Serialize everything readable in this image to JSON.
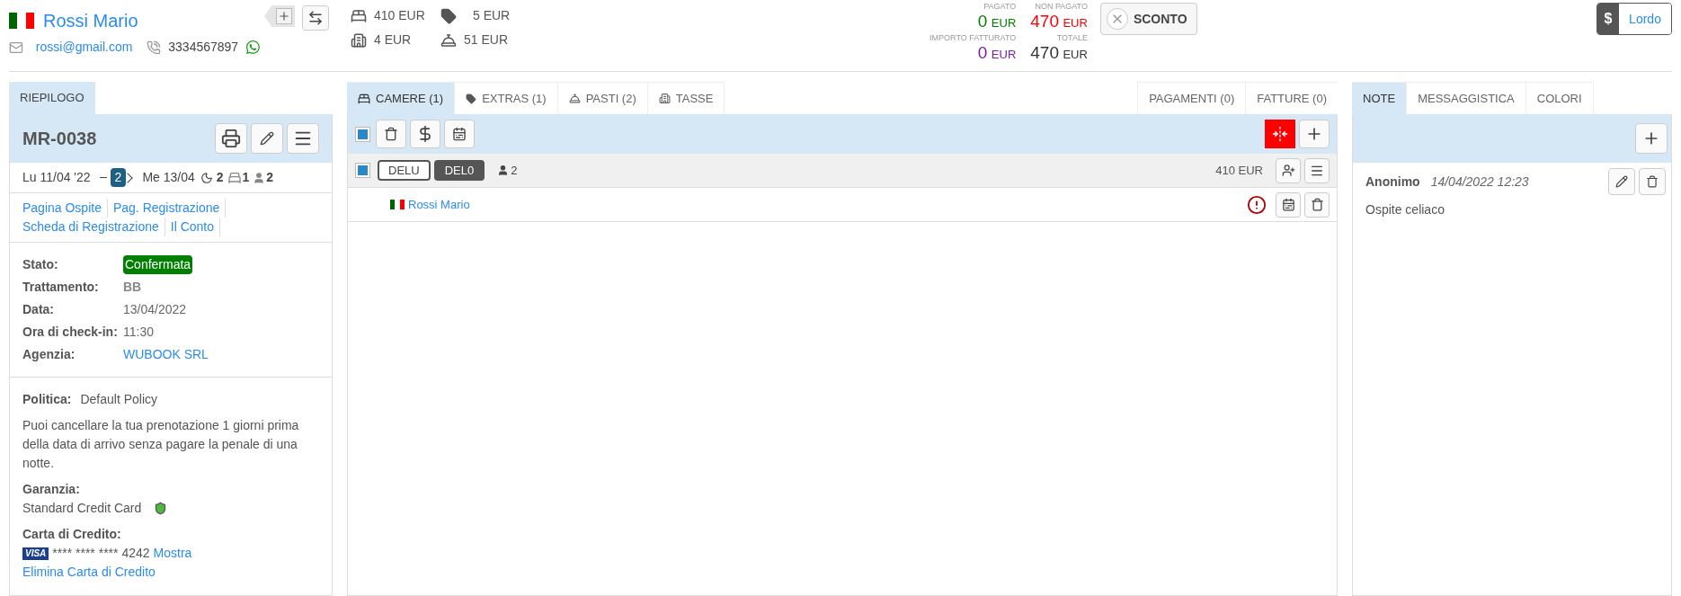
{
  "guest": {
    "name": "Rossi Mario",
    "email": "rossi@gmail.com",
    "phone": "3334567897"
  },
  "stats": [
    {
      "kind": "rooms",
      "value": "410 EUR"
    },
    {
      "kind": "extras",
      "value": "5 EUR"
    },
    {
      "kind": "taxes",
      "value": "4 EUR"
    },
    {
      "kind": "meals",
      "value": "51 EUR"
    }
  ],
  "totals": [
    {
      "label": "PAGATO",
      "amount": "0",
      "currency": "EUR",
      "color": "#008000"
    },
    {
      "label": "NON PAGATO",
      "amount": "470",
      "currency": "EUR",
      "color": "#ff0000"
    },
    {
      "label": "IMPORTO FATTURATO",
      "amount": "0",
      "currency": "EUR",
      "color": "#7b1fa2"
    },
    {
      "label": "TOTALE",
      "amount": "470",
      "currency": "EUR",
      "color": "#333333"
    }
  ],
  "discount_button": "SCONTO",
  "price_toggle": {
    "symbol": "$",
    "label": "Lordo"
  },
  "summary": {
    "tab": "RIEPILOGO",
    "code": "MR-0038",
    "checkin": "Lu 11/04 '22",
    "nights_badge": "2",
    "checkout": "Me 13/04",
    "nights": "2",
    "rooms": "1",
    "guests": "2",
    "links": [
      "Pagina Ospite",
      "Pag. Registrazione",
      "Scheda di Registrazione",
      "Il Conto"
    ],
    "fields": [
      {
        "label": "Stato:",
        "value": "Confermata",
        "kind": "badge"
      },
      {
        "label": "Trattamento:",
        "value": "BB",
        "kind": "bold"
      },
      {
        "label": "Data:",
        "value": "13/04/2022",
        "kind": "text"
      },
      {
        "label": "Ora di check-in:",
        "value": "11:30",
        "kind": "text"
      },
      {
        "label": "Agenzia:",
        "value": "WUBOOK SRL",
        "kind": "link"
      }
    ],
    "policy_label": "Politica:",
    "policy": "Default Policy",
    "policy_text": "Puoi cancellare la tua prenotazione 1 giorni prima della data di arrivo senza pagare la penale di una notte.",
    "guarantee_label": "Garanzia:",
    "guarantee": "Standard Credit Card",
    "card_label": "Carta di Credito:",
    "card_brand": "VISA",
    "card_number": "**** **** **** 4242",
    "card_show": "Mostra",
    "card_delete": "Elimina Carta di Credito"
  },
  "room_tabs": [
    {
      "label": "CAMERE (1)",
      "kind": "bed",
      "selected": true
    },
    {
      "label": "EXTRAS (1)",
      "kind": "tag",
      "selected": false
    },
    {
      "label": "PASTI (2)",
      "kind": "meal",
      "selected": false
    },
    {
      "label": "TASSE",
      "kind": "building",
      "selected": false
    }
  ],
  "right_tabs": [
    {
      "label": "PAGAMENTI (0)",
      "selected": false
    },
    {
      "label": "FATTURE (0)",
      "selected": false
    }
  ],
  "toolbar": {
    "checked": true
  },
  "room": {
    "checked": true,
    "codes": [
      {
        "label": "DELU",
        "selected": false
      },
      {
        "label": "DEL0",
        "selected": true
      }
    ],
    "guests": "2",
    "price": "410 EUR",
    "occupant": "Rossi Mario"
  },
  "note_tabs": [
    {
      "label": "NOTE",
      "selected": true
    },
    {
      "label": "MESSAGGISTICA",
      "selected": false
    },
    {
      "label": "COLORI",
      "selected": false
    }
  ],
  "note": {
    "author": "Anonimo",
    "date": "14/04/2022 12:23",
    "text": "Ospite celiaco"
  }
}
